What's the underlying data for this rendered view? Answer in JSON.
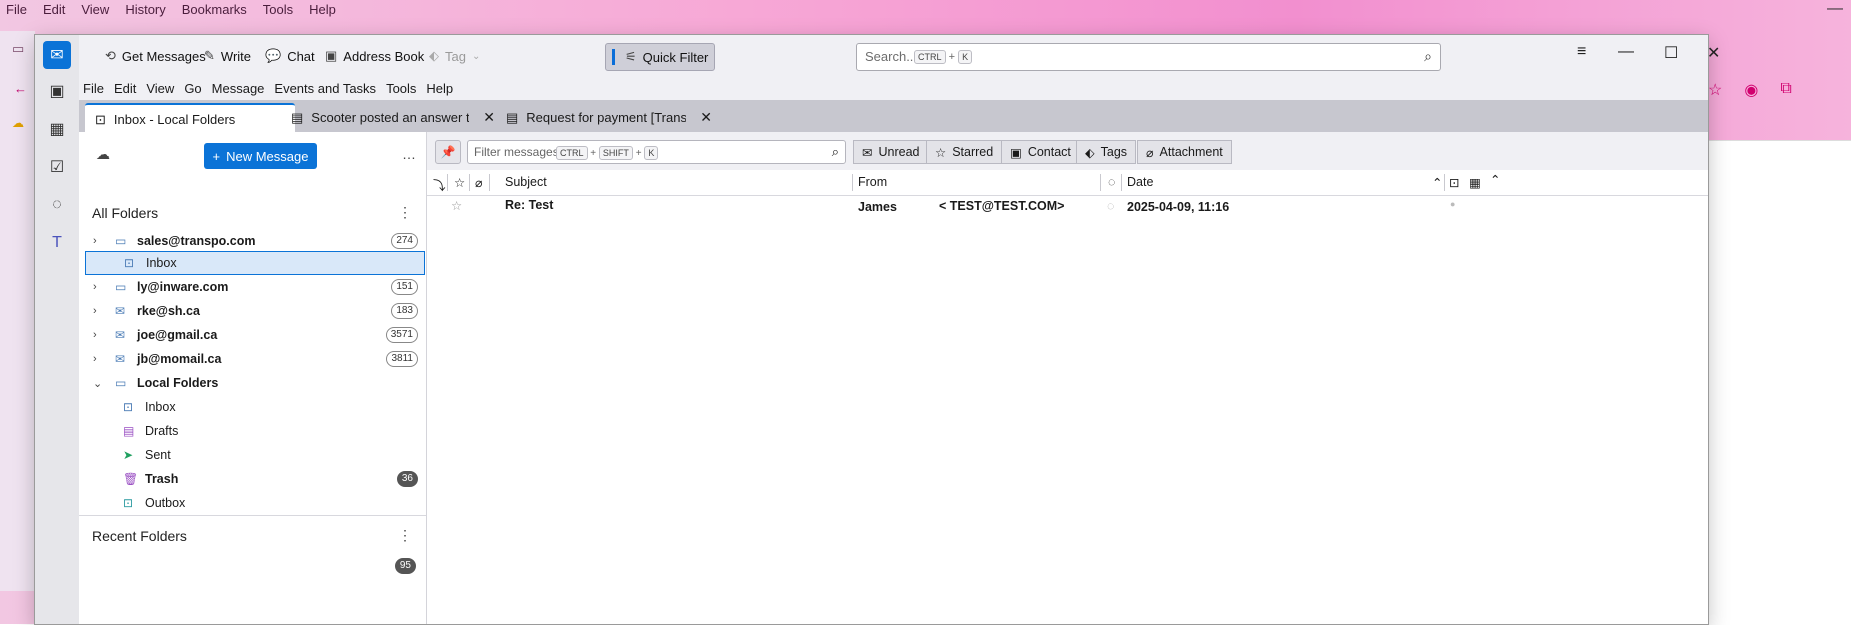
{
  "background_app": {
    "menu": [
      "File",
      "Edit",
      "View",
      "History",
      "Bookmarks",
      "Tools",
      "Help"
    ],
    "window_minimize_icon": "minimize-icon"
  },
  "toolbar": {
    "get_messages": "Get Messages",
    "write": "Write",
    "chat": "Chat",
    "address_book": "Address Book",
    "tag": "Tag",
    "quick_filter": "Quick Filter",
    "search_placeholder": "Search...",
    "search_key_1": "CTRL",
    "search_key_plus": "+",
    "search_key_2": "K"
  },
  "menu": [
    "File",
    "Edit",
    "View",
    "Go",
    "Message",
    "Events and Tasks",
    "Tools",
    "Help"
  ],
  "tabs": [
    {
      "label": "Inbox - Local Folders"
    },
    {
      "label": "Scooter posted an answer to your q"
    },
    {
      "label": "Request for payment [Transaction #"
    }
  ],
  "folder_pane": {
    "new_message": "New Message",
    "all_folders": "All Folders",
    "recent_folders": "Recent Folders",
    "folders": [
      {
        "label": "sales@transpo.com",
        "count": "274"
      },
      {
        "label": "Inbox"
      },
      {
        "label": "ly@inware.com",
        "count": "151"
      },
      {
        "label": "rke@sh.ca",
        "count": "183"
      },
      {
        "label": "joe@gmail.ca",
        "count": "3571"
      },
      {
        "label": "jb@momail.ca",
        "count": "3811"
      },
      {
        "label": "Local Folders"
      },
      {
        "label": "Inbox"
      },
      {
        "label": "Drafts"
      },
      {
        "label": "Sent"
      },
      {
        "label": "Trash",
        "count": "36"
      },
      {
        "label": "Outbox"
      }
    ],
    "recent_partial_count": "95"
  },
  "quick_filter": {
    "placeholder": "Filter messages...",
    "key1": "CTRL",
    "key2": "SHIFT",
    "key3": "K",
    "plus": "+",
    "buttons": [
      "Unread",
      "Starred",
      "Contact",
      "Tags",
      "Attachment"
    ]
  },
  "columns": {
    "subject": "Subject",
    "from": "From",
    "date": "Date"
  },
  "messages": [
    {
      "subject": "Re: Test",
      "from_name": "James",
      "from_email": "< TEST@TEST.COM>",
      "date": "2025-04-09, 11:16"
    }
  ],
  "colors": {
    "accent": "#0b73d7",
    "bg_window": "#f0f0f4",
    "tabbar": "#c7c7cf"
  }
}
